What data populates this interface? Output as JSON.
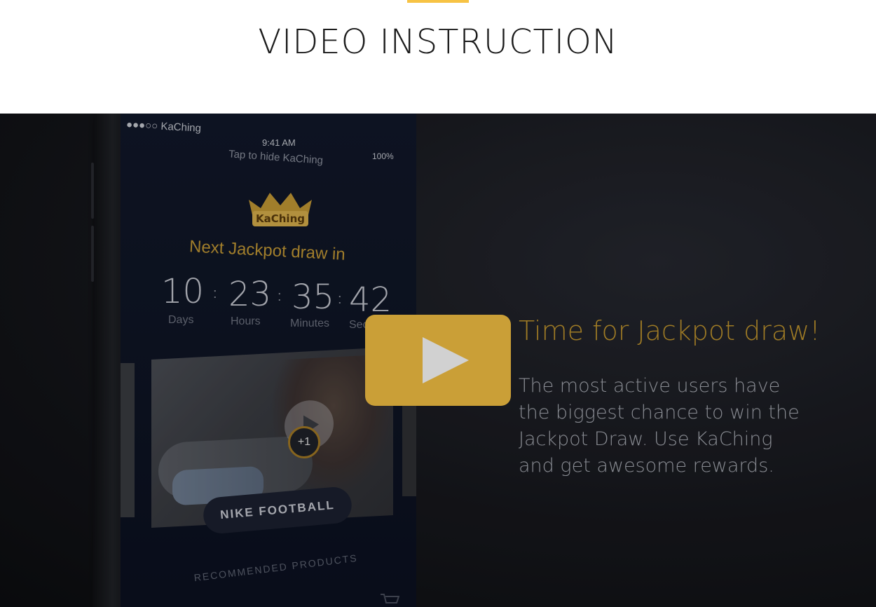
{
  "section": {
    "title": "VIDEO INSTRUCTION",
    "accent_color": "#f7c344"
  },
  "phone": {
    "status_carrier": "●●●○○ KaChing",
    "status_time": "9:41 AM",
    "status_battery": "100%",
    "tap_hint": "Tap to hide KaChing",
    "logo_text": "KaChing",
    "next_jackpot": "Next Jackpot draw in",
    "countdown": {
      "days_value": "10",
      "days_label": "Days",
      "hours_value": "23",
      "hours_label": "Hours",
      "minutes_value": "35",
      "minutes_label": "Minutes",
      "seconds_value": "42",
      "seconds_label": "Sec"
    },
    "badge": "+1",
    "card_label": "NIKE FOOTBALL",
    "recommended": "RECOMMENDED PRODUCTS"
  },
  "overlay": {
    "heading": "Time for Jackpot draw!",
    "description": "The most active users have the biggest chance to win the Jackpot Draw. Use KaChing and get awesome rewards.",
    "heading_color": "#c2962e"
  },
  "play_button": {
    "icon": "play-icon",
    "color": "#f7c344"
  }
}
